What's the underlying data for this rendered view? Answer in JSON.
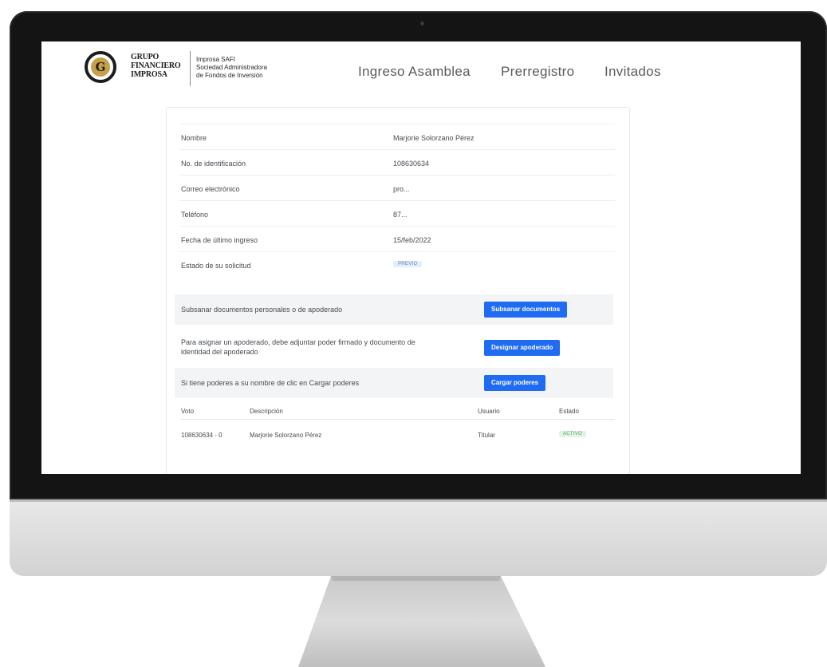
{
  "brand": {
    "logo_letter": "G",
    "name_lines": [
      "GRUPO",
      "FINANCIERO",
      "IMPROSA"
    ],
    "sub_lines": [
      "Improsa SAFI",
      "Sociedad Administradora",
      "de Fondos de Inversión"
    ]
  },
  "nav": {
    "items": [
      {
        "label": "Ingreso Asamblea"
      },
      {
        "label": "Prerregistro"
      },
      {
        "label": "Invitados"
      }
    ]
  },
  "details": {
    "rows": [
      {
        "label": "Nombre",
        "value": "Marjorie Solorzano Pérez"
      },
      {
        "label": "No. de identificación",
        "value": "108630634"
      },
      {
        "label": "Correo electrónico",
        "value": "pro..."
      },
      {
        "label": "Teléfono",
        "value": "87..."
      },
      {
        "label": "Fecha de último ingreso",
        "value": "15/feb/2022"
      }
    ],
    "status_label": "Estado de su solicitud",
    "status_badge": "PREVIO"
  },
  "actions": [
    {
      "text": "Subsanar documentos personales o de apoderado",
      "button": "Subsanar documentos"
    },
    {
      "text": "Para asignar un apoderado, debe adjuntar poder firmado y documento de identidad del apoderado",
      "button": "Designar apoderado"
    },
    {
      "text": "Si tiene poderes a su nombre de clic en Cargar poderes",
      "button": "Cargar poderes"
    }
  ],
  "votes_table": {
    "headers": [
      "Voto",
      "Descripción",
      "Usuario",
      "Estado"
    ],
    "rows": [
      {
        "voto": "108630634 - 0",
        "descripcion": "Marjorie Solorzano Pérez",
        "usuario": "Titular",
        "estado": "ACTIVO"
      }
    ]
  },
  "colors": {
    "primary_button": "#1f6bf2",
    "bezel": "#141414",
    "logo_gold": "#c7a14a"
  }
}
